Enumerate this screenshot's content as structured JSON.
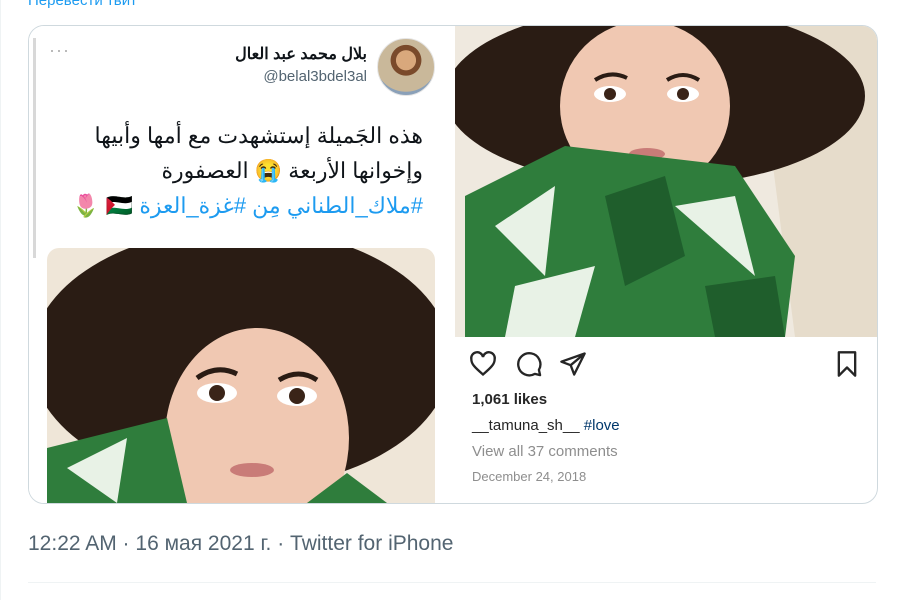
{
  "translate_link": "Перевести твит",
  "embedded_tweet": {
    "author_name": "بلال محمد عبد العال",
    "author_handle": "@belal3bdel3al",
    "text_lines": [
      "هذه الجَميلة إستشهدت مع أمها وأبيها",
      "وإخوانها الأربعة 😭 العصفورة"
    ],
    "hashtags_line": "#ملاك_الطناني مِن #غزة_العزة 🇵🇸 🌷"
  },
  "instagram": {
    "likes": "1,061 likes",
    "caption_user": "__tamuna_sh__",
    "caption_tag": "#love",
    "comments": "View all 37 comments",
    "date": "December 24, 2018",
    "icons": [
      "heart-icon",
      "comment-icon",
      "share-icon",
      "bookmark-icon"
    ]
  },
  "tweet_meta": "12:22 AM · 16 мая 2021 г. · Twitter for iPhone",
  "colors": {
    "link": "#1d9bf0",
    "border": "#cfd9de",
    "meta": "#536471"
  }
}
